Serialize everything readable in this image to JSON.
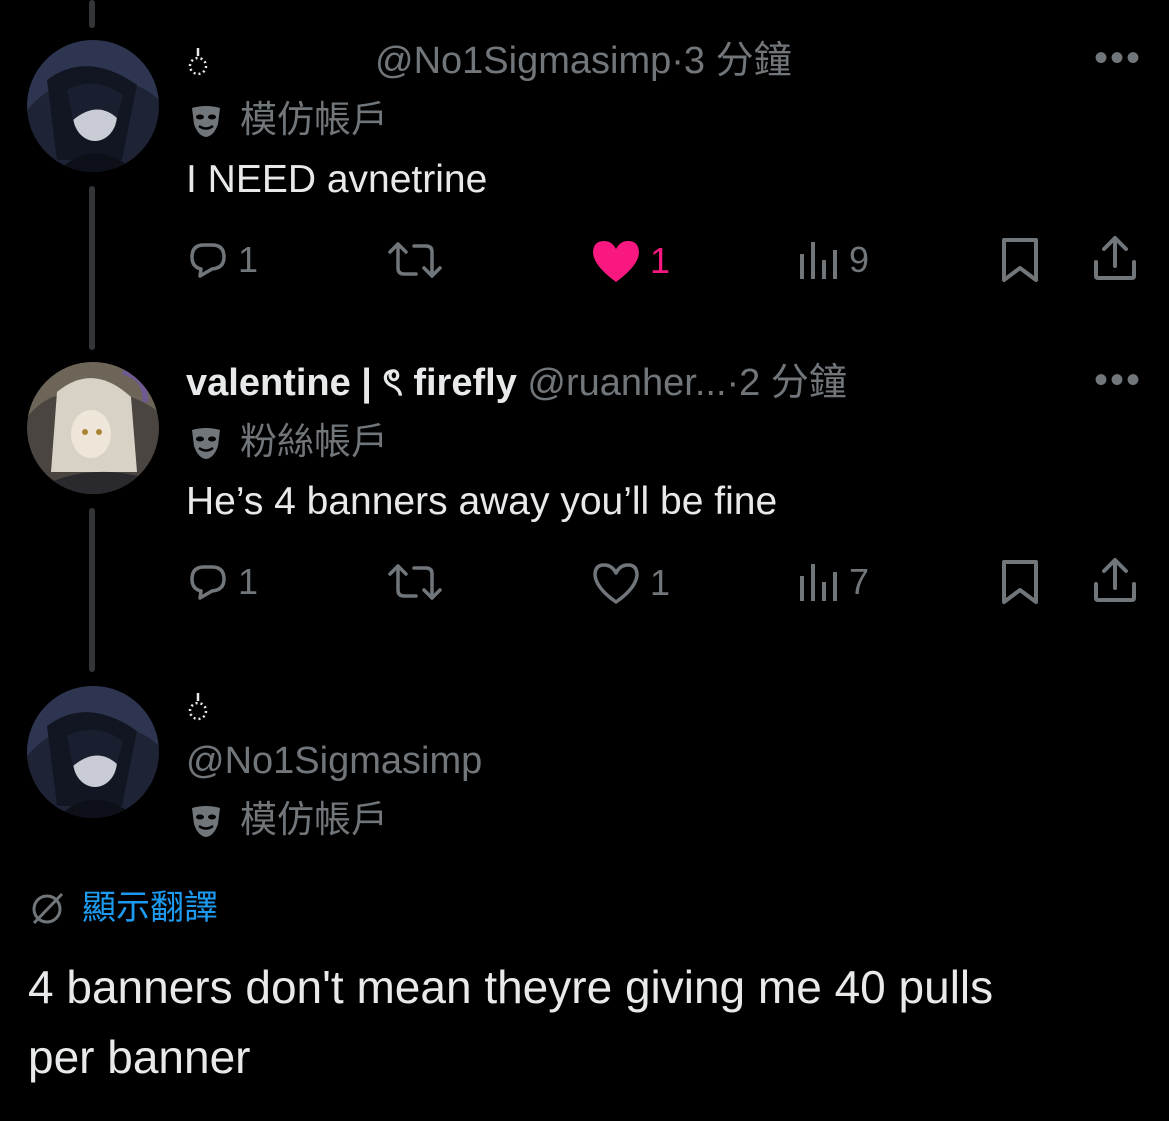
{
  "tweets": [
    {
      "display_name": "",
      "handle": "@No1Sigmasimp",
      "time": "·3 分鐘",
      "account_label": "模仿帳戶",
      "text": "I NEED avnetrine",
      "replies": "1",
      "likes": "1",
      "liked": true,
      "views": "9"
    },
    {
      "display_name": "valentine | ৎ firefly",
      "handle": "@ruanher...",
      "time": "·2 分鐘",
      "account_label": "粉絲帳戶",
      "text": "He’s 4 banners away you’ll be fine",
      "replies": "1",
      "likes": "1",
      "liked": false,
      "views": "7"
    }
  ],
  "main_tweet": {
    "handle": "@No1Sigmasimp",
    "account_label": "模仿帳戶",
    "translate_label": "顯示翻譯",
    "text_line1": "4 banners don't mean theyre giving me 40 pulls",
    "text_line2": "per banner"
  },
  "colors": {
    "background": "#000000",
    "text": "#e7e9ea",
    "secondary": "#71767b",
    "like_pink": "#f91880",
    "link_blue": "#1d9bf0"
  }
}
